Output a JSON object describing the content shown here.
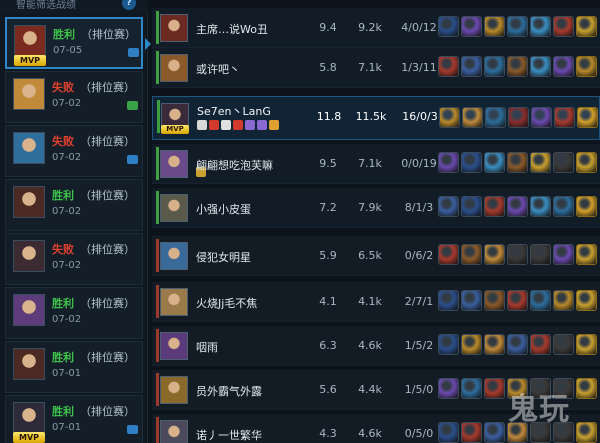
{
  "sidebar": {
    "header": "智能筛选战绩",
    "help_icon": "?",
    "matches": [
      {
        "result": "胜利",
        "type": "（排位赛）",
        "date": "07-05",
        "mvp": true,
        "selected": true,
        "mini": "blue",
        "res": "win"
      },
      {
        "result": "失败",
        "type": "（排位赛）",
        "date": "07-02",
        "mvp": false,
        "mini": "green",
        "res": "lose"
      },
      {
        "result": "失败",
        "type": "（排位赛）",
        "date": "07-02",
        "mvp": false,
        "mini": "blue",
        "res": "lose"
      },
      {
        "result": "胜利",
        "type": "（排位赛）",
        "date": "07-02",
        "mvp": false,
        "mini": "",
        "res": "win"
      },
      {
        "result": "失败",
        "type": "（排位赛）",
        "date": "07-02",
        "mvp": false,
        "mini": "",
        "res": "lose"
      },
      {
        "result": "胜利",
        "type": "（排位赛）",
        "date": "07-02",
        "mvp": false,
        "mini": "",
        "res": "win"
      },
      {
        "result": "胜利",
        "type": "（排位赛）",
        "date": "07-01",
        "mvp": false,
        "mini": "",
        "res": "win"
      },
      {
        "result": "胜利",
        "type": "（排位赛）",
        "date": "07-01",
        "mvp": true,
        "mini": "blue",
        "res": "win"
      }
    ],
    "mvp_label": "MVP"
  },
  "rows": [
    {
      "name": "主席…说Wo丑",
      "score": "9.4",
      "gold": "9.2k",
      "kda": "4/0/12",
      "team": "ally"
    },
    {
      "name": "或许吧丶",
      "score": "5.8",
      "gold": "7.1k",
      "kda": "1/3/11",
      "team": "ally"
    },
    {
      "name": "Se7en丶LanG",
      "score": "11.8",
      "gold": "11.5k",
      "kda": "16/0/3",
      "team": "ally",
      "me": true
    },
    {
      "name": "翩翩想吃泡芙嘛",
      "score": "9.5",
      "gold": "7.1k",
      "kda": "0/0/19",
      "team": "ally"
    },
    {
      "name": "小强小皮蛋",
      "score": "7.2",
      "gold": "7.9k",
      "kda": "8/1/3",
      "team": "ally"
    },
    {
      "name": "侵犯女明星",
      "score": "5.9",
      "gold": "6.5k",
      "kda": "0/6/2",
      "team": "enemy"
    },
    {
      "name": "火烧Jj毛不焦",
      "score": "4.1",
      "gold": "4.1k",
      "kda": "2/7/1",
      "team": "enemy"
    },
    {
      "name": "咽雨",
      "score": "6.3",
      "gold": "4.6k",
      "kda": "1/5/2",
      "team": "enemy"
    },
    {
      "name": "员外霸气外露",
      "score": "5.6",
      "gold": "4.4k",
      "kda": "1/5/0",
      "team": "enemy"
    },
    {
      "name": "诺丿一世繁华",
      "score": "4.3",
      "gold": "4.6k",
      "kda": "0/5/0",
      "team": "enemy"
    }
  ],
  "me_mvp_label": "MVP",
  "watermark": "鬼玩",
  "colors": {
    "win": "#3ec24a",
    "lose": "#e0402e",
    "accent": "#2d86c7"
  }
}
